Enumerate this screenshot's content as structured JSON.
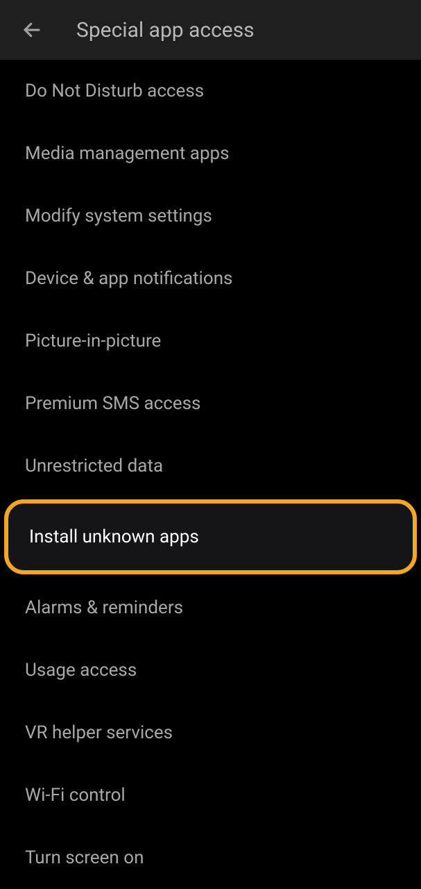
{
  "header": {
    "title": "Special app access"
  },
  "items": [
    {
      "label": "Do Not Disturb access",
      "highlighted": false
    },
    {
      "label": "Media management apps",
      "highlighted": false
    },
    {
      "label": "Modify system settings",
      "highlighted": false
    },
    {
      "label": "Device & app notifications",
      "highlighted": false
    },
    {
      "label": "Picture-in-picture",
      "highlighted": false
    },
    {
      "label": "Premium SMS access",
      "highlighted": false
    },
    {
      "label": "Unrestricted data",
      "highlighted": false
    },
    {
      "label": "Install unknown apps",
      "highlighted": true
    },
    {
      "label": "Alarms & reminders",
      "highlighted": false
    },
    {
      "label": "Usage access",
      "highlighted": false
    },
    {
      "label": "VR helper services",
      "highlighted": false
    },
    {
      "label": "Wi-Fi control",
      "highlighted": false
    },
    {
      "label": "Turn screen on",
      "highlighted": false
    }
  ]
}
